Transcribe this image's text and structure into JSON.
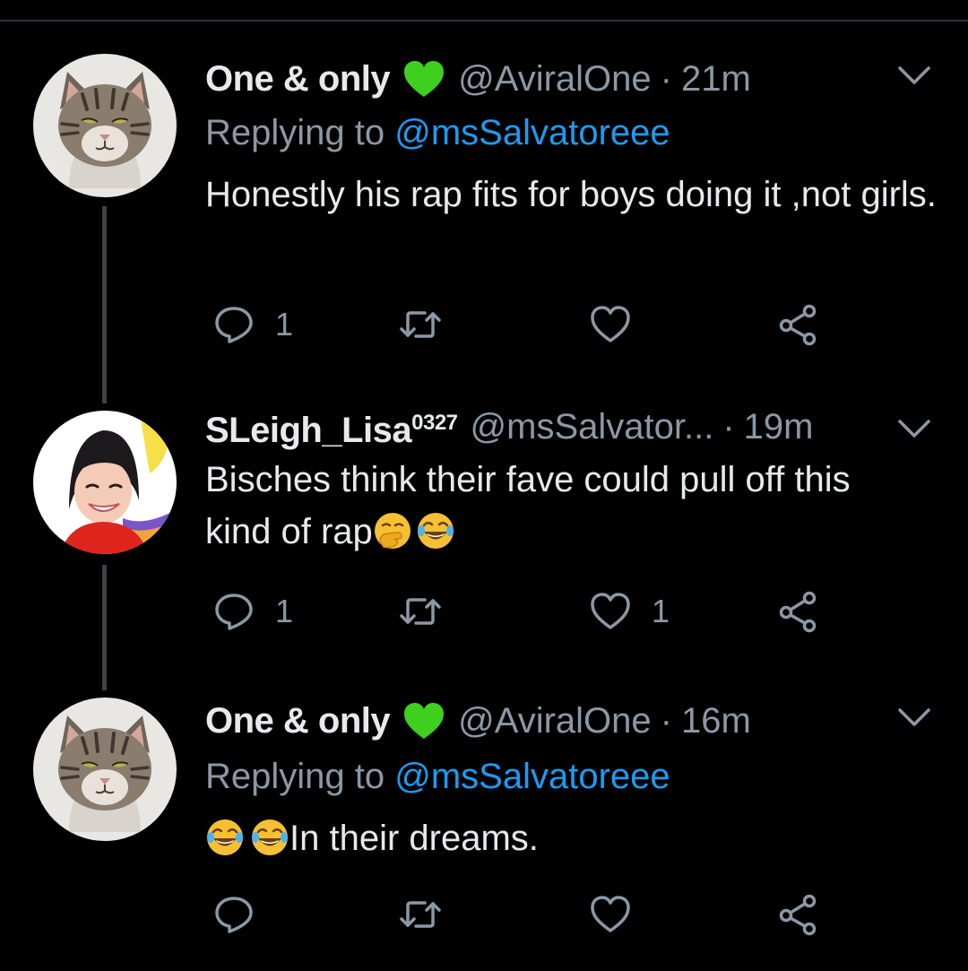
{
  "colors": {
    "background": "#000000",
    "text": "#e7e9ea",
    "secondary": "#8b98a5",
    "link": "#1d9bf0",
    "verified_heart": "#3ecf1f"
  },
  "tweets": [
    {
      "name": "One & only",
      "name_sup": "",
      "badge_icon": "green-heart-icon",
      "handle": "@AviralOne",
      "dot": "·",
      "time": "21m",
      "replying_prefix": "Replying to ",
      "replying_to": "@msSalvatoreee",
      "text": "Honestly his rap fits for boys doing it ,not girls.",
      "emojis_after": [],
      "avatar_icon": "cat-avatar-icon",
      "reply_count": "1",
      "retweet_count": "",
      "like_count": ""
    },
    {
      "name": "SLeigh_Lisa",
      "name_sup": "0327",
      "badge_icon": "",
      "handle": "@msSalvator...",
      "dot": "·",
      "time": "19m",
      "replying_prefix": "",
      "replying_to": "",
      "text": "Bisches think their fave could pull off this kind of rap",
      "emojis_after": [
        "face-with-hand-over-mouth-emoji",
        "tears-of-joy-emoji"
      ],
      "avatar_icon": "woman-smiling-avatar-icon",
      "reply_count": "1",
      "retweet_count": "",
      "like_count": "1"
    },
    {
      "name": "One & only",
      "name_sup": "",
      "badge_icon": "green-heart-icon",
      "handle": "@AviralOne",
      "dot": "·",
      "time": "16m",
      "replying_prefix": "Replying to ",
      "replying_to": "@msSalvatoreee",
      "text": "In their dreams.",
      "emojis_before": [
        "tears-of-joy-emoji",
        "tears-of-joy-emoji"
      ],
      "avatar_icon": "cat-avatar-icon",
      "reply_count": "",
      "retweet_count": "",
      "like_count": ""
    }
  ],
  "icons": {
    "reply": "reply-icon",
    "retweet": "retweet-icon",
    "like": "heart-icon",
    "share": "share-icon",
    "menu": "chevron-down-icon"
  }
}
